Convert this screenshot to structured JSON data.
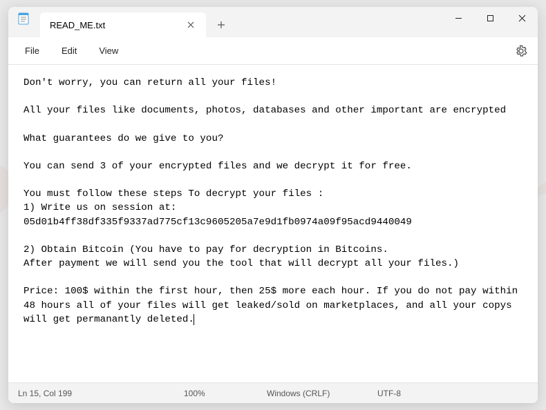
{
  "tab": {
    "title": "READ_ME.txt"
  },
  "menu": {
    "file": "File",
    "edit": "Edit",
    "view": "View"
  },
  "body": "Don't worry, you can return all your files!\n\nAll your files like documents, photos, databases and other important are encrypted\n\nWhat guarantees do we give to you?\n\nYou can send 3 of your encrypted files and we decrypt it for free.\n\nYou must follow these steps To decrypt your files :\n1) Write us on session at: 05d01b4ff38df335f9337ad775cf13c9605205a7e9d1fb0974a09f95acd9440049\n\n2) Obtain Bitcoin (You have to pay for decryption in Bitcoins.\nAfter payment we will send you the tool that will decrypt all your files.)\n\nPrice: 100$ within the first hour, then 25$ more each hour. If you do not pay within 48 hours all of your files will get leaked/sold on marketplaces, and all your copys will get permanantly deleted.",
  "status": {
    "position": "Ln 15, Col 199",
    "zoom": "100%",
    "line_ending": "Windows (CRLF)",
    "encoding": "UTF-8"
  }
}
